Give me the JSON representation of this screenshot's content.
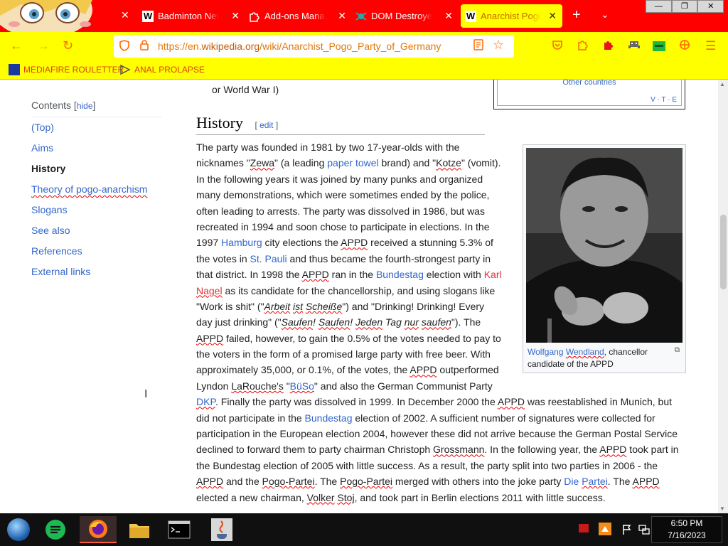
{
  "tabs": [
    {
      "label": "Badminton New",
      "favicon": "W",
      "active": false
    },
    {
      "label": "Add-ons Manage",
      "favicon": "puzzle",
      "active": false
    },
    {
      "label": "DOM Destroyer",
      "favicon": "bug",
      "active": false
    },
    {
      "label": "Anarchist Pogo P",
      "favicon": "W",
      "active": true
    }
  ],
  "window_controls": [
    "—",
    "❐",
    "✕"
  ],
  "address_bar": {
    "url_prefix": "https://en.",
    "url_domain": "wikipedia.org",
    "url_path": "/wiki/Anarchist_Pogo_Party_of_Germany"
  },
  "bookmarks": [
    {
      "label": "MEDIAFIRE ROULETTER",
      "icon": "mediafire-icon"
    },
    {
      "label": "ANAL PROLAPSE",
      "icon": "flag-icon"
    }
  ],
  "toc": {
    "title": "Contents",
    "hide_label": "hide",
    "items": [
      "(Top)",
      "Aims",
      "History",
      "Theory of pogo-anarchism",
      "Slogans",
      "See also",
      "References",
      "External links"
    ],
    "active_index": 2
  },
  "prev_line": "or World War I)",
  "infobox": {
    "other_label": "Other countries",
    "vte": "V · T · E"
  },
  "section": {
    "title": "History",
    "edit_label": "edit"
  },
  "image": {
    "caption_link1": "Wolfgang",
    "caption_link2": "Wendland",
    "caption_rest": ", chancellor candidate of the APPD"
  },
  "article": {
    "l1": "The party was founded in 1981 by two 17-year-olds with the",
    "l2a": "nicknames \"",
    "l2b": "Zewa",
    "l2c": "\" (a leading ",
    "l2d": "paper towel",
    "l2e": " brand) and \"",
    "l2f": "Kotze",
    "l2g": "\" (vomit).",
    "l3": "In the following years it was joined by many punks and organized",
    "l4": "many demonstrations, which were sometimes ended by the police,",
    "l5": "often leading to arrests. The party was dissolved in 1986, but was",
    "l6": "recreated in 1994 and soon chose to participate in elections. In the",
    "l7a": "1997 ",
    "l7b": "Hamburg",
    "l7c": " city elections the ",
    "l7d": "APPD",
    "l7e": " received a stunning 5.3% of",
    "l8a": "the votes in ",
    "l8b": "St. Pauli",
    "l8c": " and thus became the fourth-strongest party in",
    "l9a": "that district. In 1998 the ",
    "l9b": "APPD",
    "l9c": " ran in the ",
    "l9d": "Bundestag",
    "l9e": " election with ",
    "l9f": "Karl",
    "l10a": "Nagel",
    "l10b": " as its candidate for the chancellorship, and using slogans like",
    "l11a": "\"Work is shit\" (\"",
    "l11b": "Arbeit",
    "l11c": " ",
    "l11d": "ist",
    "l11e": " ",
    "l11f": "Scheiße",
    "l11g": "\") and \"Drinking! Drinking! Every",
    "l12a": "day just drinking\" (\"",
    "l12b": "Saufen",
    "l12c": "! ",
    "l12d": "Saufen",
    "l12e": "! ",
    "l12f": "Jeden",
    "l12g": " Tag ",
    "l12h": "nur",
    "l12i": " ",
    "l12j": "saufen",
    "l12k": "\"). The",
    "l13a": "APPD",
    "l13b": " failed, however, to gain the 0.5% of the votes needed to pay to",
    "l14": "the voters in the form of a promised large party with free beer. With",
    "l15a": "approximately 35,000, or 0.1%, of the votes, the ",
    "l15b": "APPD",
    "l15c": " outperformed",
    "l16a": "Lyndon ",
    "l16b": "LaRouche's",
    "l16c": " \"",
    "l16d": "BüSo",
    "l16e": "\" and also the German Communist Party",
    "l17a": "DKP",
    "l17b": ". Finally the party was dissolved in 1999. In December 2000 the ",
    "l17c": "APPD",
    "l17d": " was reestablished in Munich, but",
    "l18a": "did not participate in the ",
    "l18b": "Bundestag",
    "l18c": " election of 2002. A sufficient number of signatures were collected for",
    "l19": "participation in the European election 2004, however these did not arrive because the German Postal Service",
    "l20a": "declined to forward them to party chairman Christoph ",
    "l20b": "Grossmann",
    "l20c": ". In the following year, the ",
    "l20d": "APPD",
    "l20e": " took part in",
    "l21": "the Bundestag election of 2005 with little success. As a result, the party split into two parties in 2006 - the",
    "l22a": "APPD",
    "l22b": " and the ",
    "l22c": "Pogo-Partei",
    "l22d": ". The ",
    "l22e": "Pogo-Partei",
    "l22f": " merged with others into the joke party ",
    "l22g": "Die",
    "l22h": " ",
    "l22i": "Partei",
    "l22j": ". The ",
    "l22k": "APPD",
    "l23a": "elected a new chairman, ",
    "l23b": "Volker",
    "l23c": " ",
    "l23d": "Stoj",
    "l23e": ", and took part in Berlin elections 2011 with little success."
  },
  "clock": {
    "time": "6:50 PM",
    "date": "7/16/2023"
  },
  "colors": {
    "tabbar": "#ff0000",
    "navbar": "#ffff00",
    "link": "#3366cc",
    "redlink": "#dd3333"
  }
}
